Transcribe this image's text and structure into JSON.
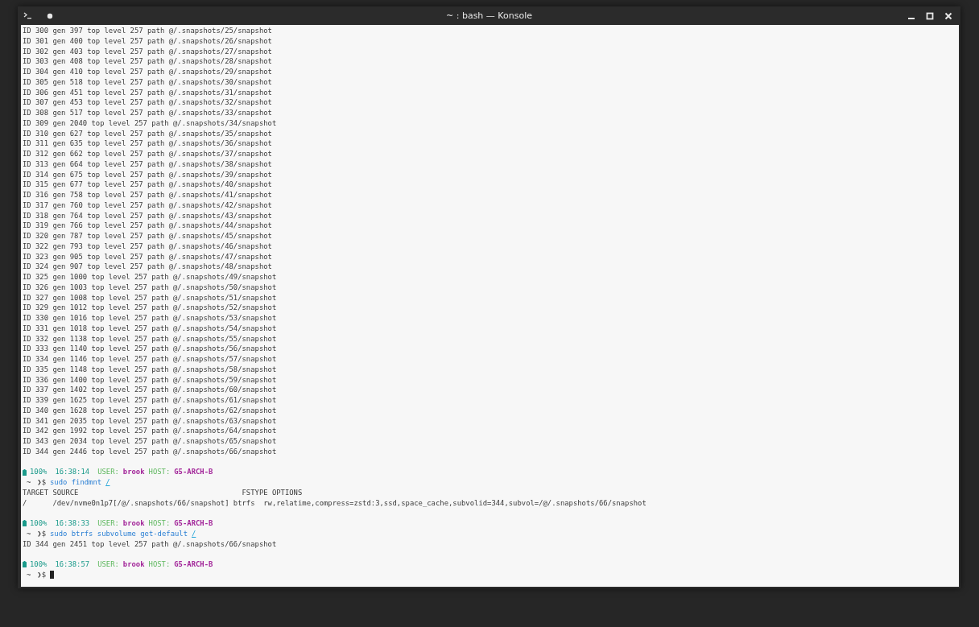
{
  "window": {
    "title": "~ : bash — Konsole"
  },
  "lines": [
    {
      "kind": "output",
      "text": "ID 300 gen 397 top level 257 path @/.snapshots/25/snapshot"
    },
    {
      "kind": "output",
      "text": "ID 301 gen 400 top level 257 path @/.snapshots/26/snapshot"
    },
    {
      "kind": "output",
      "text": "ID 302 gen 403 top level 257 path @/.snapshots/27/snapshot"
    },
    {
      "kind": "output",
      "text": "ID 303 gen 408 top level 257 path @/.snapshots/28/snapshot"
    },
    {
      "kind": "output",
      "text": "ID 304 gen 410 top level 257 path @/.snapshots/29/snapshot"
    },
    {
      "kind": "output",
      "text": "ID 305 gen 518 top level 257 path @/.snapshots/30/snapshot"
    },
    {
      "kind": "output",
      "text": "ID 306 gen 451 top level 257 path @/.snapshots/31/snapshot"
    },
    {
      "kind": "output",
      "text": "ID 307 gen 453 top level 257 path @/.snapshots/32/snapshot"
    },
    {
      "kind": "output",
      "text": "ID 308 gen 517 top level 257 path @/.snapshots/33/snapshot"
    },
    {
      "kind": "output",
      "text": "ID 309 gen 2040 top level 257 path @/.snapshots/34/snapshot"
    },
    {
      "kind": "output",
      "text": "ID 310 gen 627 top level 257 path @/.snapshots/35/snapshot"
    },
    {
      "kind": "output",
      "text": "ID 311 gen 635 top level 257 path @/.snapshots/36/snapshot"
    },
    {
      "kind": "output",
      "text": "ID 312 gen 662 top level 257 path @/.snapshots/37/snapshot"
    },
    {
      "kind": "output",
      "text": "ID 313 gen 664 top level 257 path @/.snapshots/38/snapshot"
    },
    {
      "kind": "output",
      "text": "ID 314 gen 675 top level 257 path @/.snapshots/39/snapshot"
    },
    {
      "kind": "output",
      "text": "ID 315 gen 677 top level 257 path @/.snapshots/40/snapshot"
    },
    {
      "kind": "output",
      "text": "ID 316 gen 758 top level 257 path @/.snapshots/41/snapshot"
    },
    {
      "kind": "output",
      "text": "ID 317 gen 760 top level 257 path @/.snapshots/42/snapshot"
    },
    {
      "kind": "output",
      "text": "ID 318 gen 764 top level 257 path @/.snapshots/43/snapshot"
    },
    {
      "kind": "output",
      "text": "ID 319 gen 766 top level 257 path @/.snapshots/44/snapshot"
    },
    {
      "kind": "output",
      "text": "ID 320 gen 787 top level 257 path @/.snapshots/45/snapshot"
    },
    {
      "kind": "output",
      "text": "ID 322 gen 793 top level 257 path @/.snapshots/46/snapshot"
    },
    {
      "kind": "output",
      "text": "ID 323 gen 905 top level 257 path @/.snapshots/47/snapshot"
    },
    {
      "kind": "output",
      "text": "ID 324 gen 907 top level 257 path @/.snapshots/48/snapshot"
    },
    {
      "kind": "output",
      "text": "ID 325 gen 1000 top level 257 path @/.snapshots/49/snapshot"
    },
    {
      "kind": "output",
      "text": "ID 326 gen 1003 top level 257 path @/.snapshots/50/snapshot"
    },
    {
      "kind": "output",
      "text": "ID 327 gen 1008 top level 257 path @/.snapshots/51/snapshot"
    },
    {
      "kind": "output",
      "text": "ID 329 gen 1012 top level 257 path @/.snapshots/52/snapshot"
    },
    {
      "kind": "output",
      "text": "ID 330 gen 1016 top level 257 path @/.snapshots/53/snapshot"
    },
    {
      "kind": "output",
      "text": "ID 331 gen 1018 top level 257 path @/.snapshots/54/snapshot"
    },
    {
      "kind": "output",
      "text": "ID 332 gen 1138 top level 257 path @/.snapshots/55/snapshot"
    },
    {
      "kind": "output",
      "text": "ID 333 gen 1140 top level 257 path @/.snapshots/56/snapshot"
    },
    {
      "kind": "output",
      "text": "ID 334 gen 1146 top level 257 path @/.snapshots/57/snapshot"
    },
    {
      "kind": "output",
      "text": "ID 335 gen 1148 top level 257 path @/.snapshots/58/snapshot"
    },
    {
      "kind": "output",
      "text": "ID 336 gen 1400 top level 257 path @/.snapshots/59/snapshot"
    },
    {
      "kind": "output",
      "text": "ID 337 gen 1402 top level 257 path @/.snapshots/60/snapshot"
    },
    {
      "kind": "output",
      "text": "ID 339 gen 1625 top level 257 path @/.snapshots/61/snapshot"
    },
    {
      "kind": "output",
      "text": "ID 340 gen 1628 top level 257 path @/.snapshots/62/snapshot"
    },
    {
      "kind": "output",
      "text": "ID 341 gen 2035 top level 257 path @/.snapshots/63/snapshot"
    },
    {
      "kind": "output",
      "text": "ID 342 gen 1992 top level 257 path @/.snapshots/64/snapshot"
    },
    {
      "kind": "output",
      "text": "ID 343 gen 2034 top level 257 path @/.snapshots/65/snapshot"
    },
    {
      "kind": "output",
      "text": "ID 344 gen 2446 top level 257 path @/.snapshots/66/snapshot"
    },
    {
      "kind": "status",
      "battery": "100%",
      "time": "16:38:14",
      "user_label": "USER:",
      "user": "brook",
      "host_label": "HOST:",
      "host": "G5-ARCH-B"
    },
    {
      "kind": "command",
      "dir": "~",
      "symbol": "❯$",
      "command": "sudo findmnt",
      "arg": "/",
      "cursor": false
    },
    {
      "kind": "output",
      "text": "TARGET SOURCE                                      FSTYPE OPTIONS"
    },
    {
      "kind": "output",
      "text": "/      /dev/nvme0n1p7[/@/.snapshots/66/snapshot] btrfs  rw,relatime,compress=zstd:3,ssd,space_cache,subvolid=344,subvol=/@/.snapshots/66/snapshot"
    },
    {
      "kind": "status",
      "battery": "100%",
      "time": "16:38:33",
      "user_label": "USER:",
      "user": "brook",
      "host_label": "HOST:",
      "host": "G5-ARCH-B"
    },
    {
      "kind": "command",
      "dir": "~",
      "symbol": "❯$",
      "command": "sudo btrfs subvolume get-default",
      "arg": "/",
      "cursor": false
    },
    {
      "kind": "output",
      "text": "ID 344 gen 2451 top level 257 path @/.snapshots/66/snapshot"
    },
    {
      "kind": "status",
      "battery": "100%",
      "time": "16:38:57",
      "user_label": "USER:",
      "user": "brook",
      "host_label": "HOST:",
      "host": "G5-ARCH-B"
    },
    {
      "kind": "command",
      "dir": "~",
      "symbol": "❯$",
      "cursor": true
    }
  ]
}
